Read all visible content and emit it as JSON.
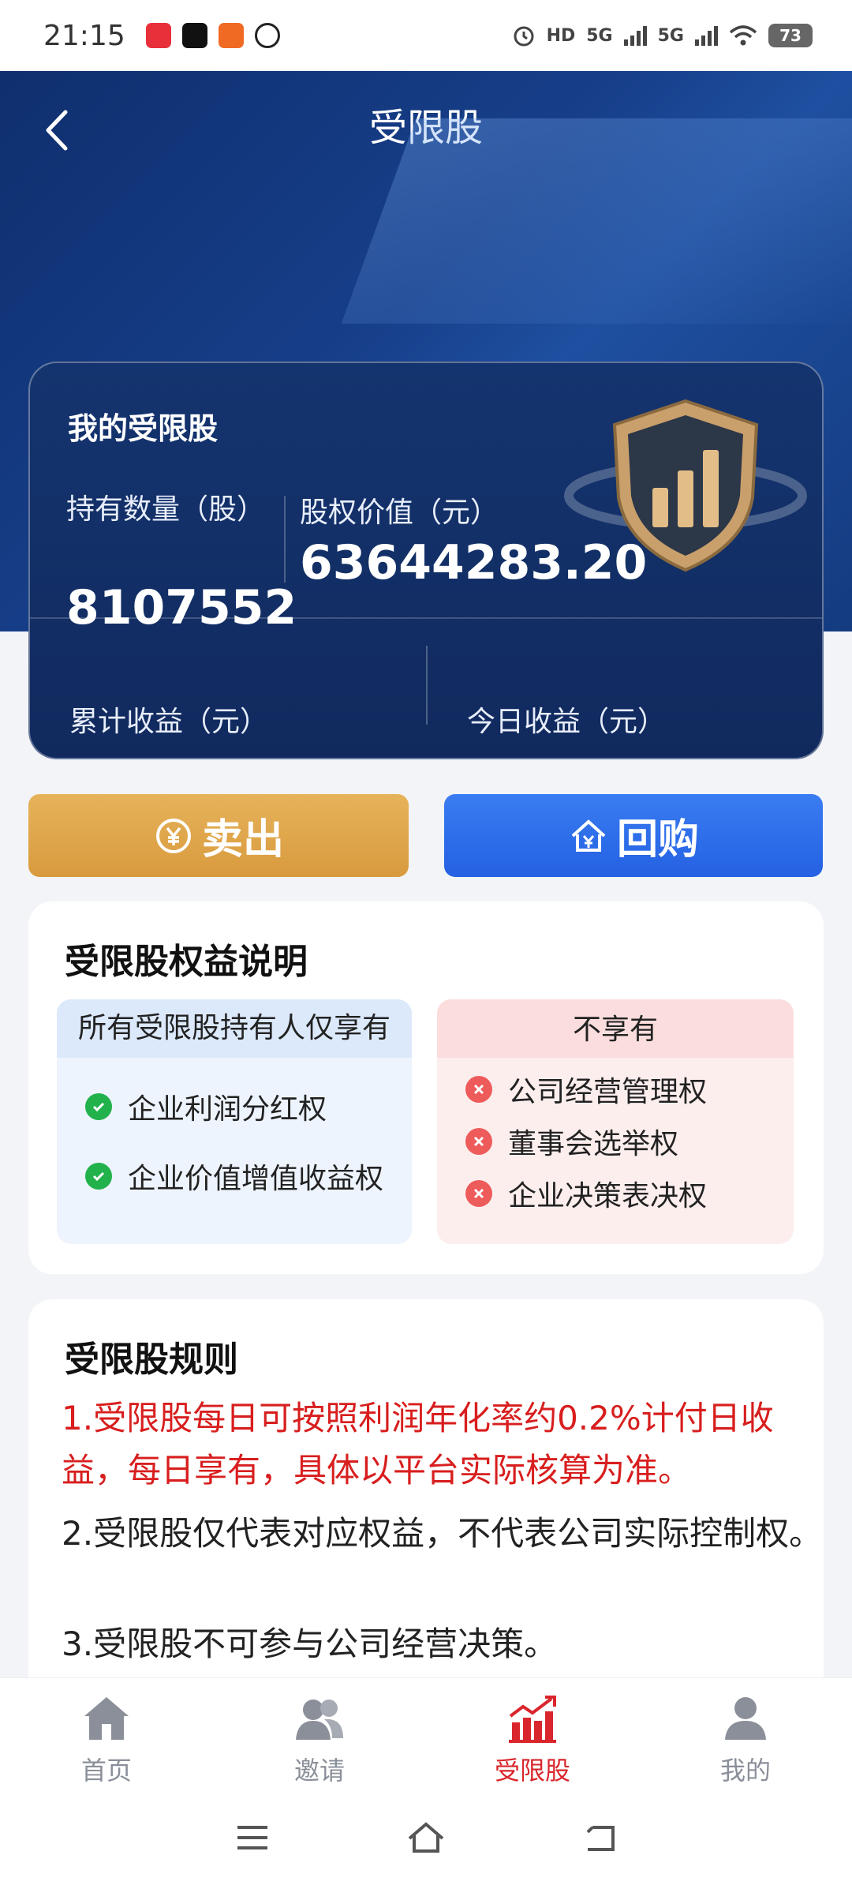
{
  "status_bar": {
    "time": "21:15",
    "network": "5G",
    "battery": "73",
    "app_icon_colors": [
      "#e8303a",
      "#111111",
      "#f06a24",
      "#222222"
    ]
  },
  "header": {
    "title": "受限股",
    "back_icon": "chevron-left-icon"
  },
  "summary_card": {
    "title": "我的受限股",
    "quantity_label": "持有数量（股）",
    "quantity_value": "8107552",
    "equity_value_label": "股权价值（元）",
    "equity_value": "63644283.20",
    "cumulative_income_label": "累计收益（元）",
    "today_income_label": "今日收益（元）",
    "badge_icon": "shield-chart-icon"
  },
  "actions": {
    "sell_label": "卖出",
    "sell_icon": "yen-cycle-icon",
    "buyback_label": "回购",
    "buyback_icon": "house-yen-icon",
    "sell_color": "#dfa64a",
    "buyback_color": "#2f6eea"
  },
  "rights": {
    "title": "受限股权益说明",
    "have_header": "所有受限股持有人仅享有",
    "have_items": [
      "企业利润分红权",
      "企业价值增值收益权"
    ],
    "not_have_header": "不享有",
    "not_have_items": [
      "公司经营管理权",
      "董事会选举权",
      "企业决策表决权"
    ]
  },
  "rules": {
    "title": "受限股规则",
    "items": [
      "1.受限股每日可按照利润年化率约0.2%计付日收益，每日享有，具体以平台实际核算为准。",
      "2.受限股仅代表对应权益，不代表公司实际控制权。",
      "3.受限股不可参与公司经营决策。"
    ]
  },
  "bottom_nav": {
    "items": [
      {
        "label": "首页",
        "icon": "home-icon"
      },
      {
        "label": "邀请",
        "icon": "users-icon"
      },
      {
        "label": "受限股",
        "icon": "chart-up-icon",
        "active": true
      },
      {
        "label": "我的",
        "icon": "profile-icon"
      }
    ],
    "active_color": "#d9262c"
  }
}
